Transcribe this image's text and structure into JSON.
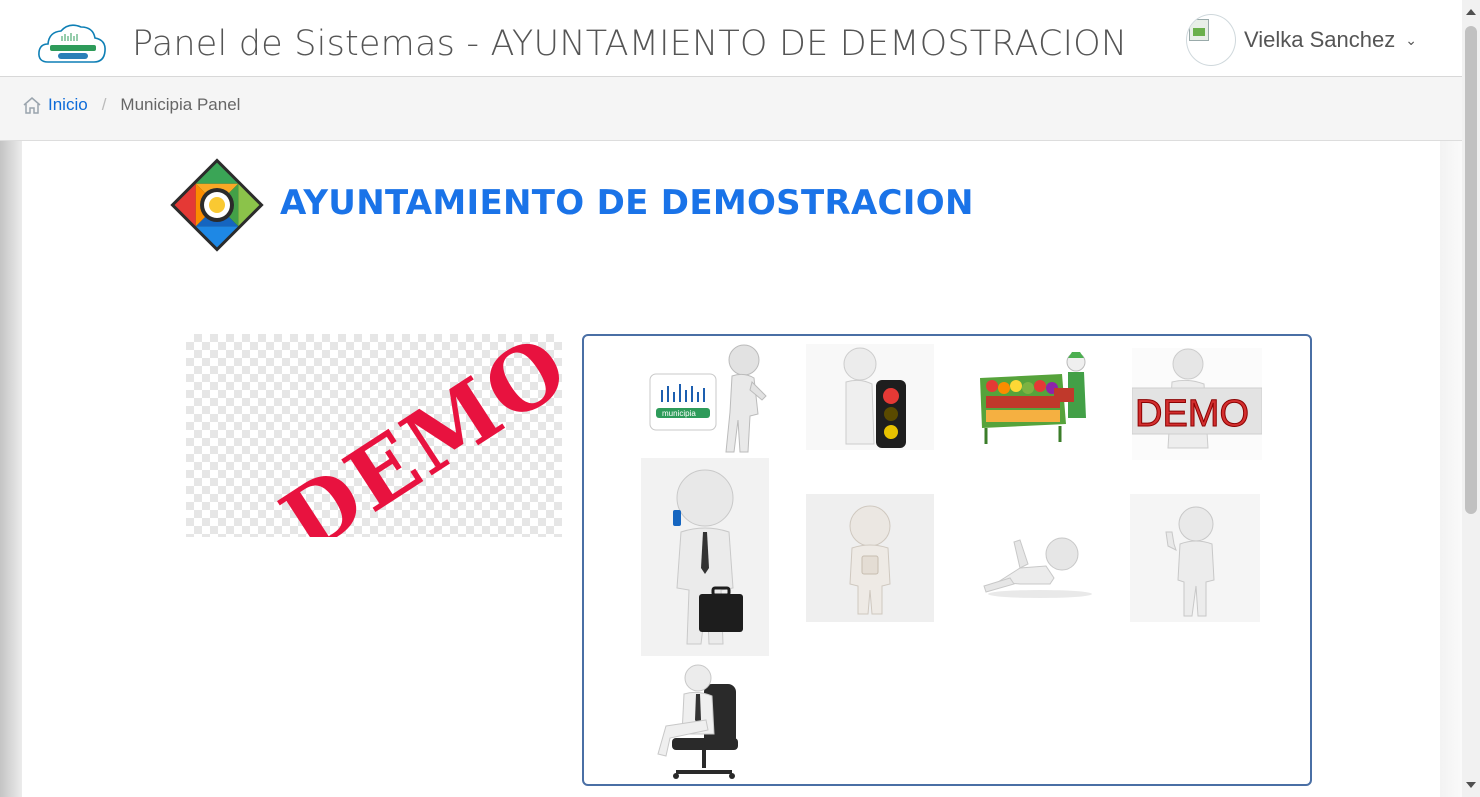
{
  "header": {
    "title": "Panel de Sistemas - AYUNTAMIENTO DE DEMOSTRACION",
    "logo_icon": "municipia-cloud-logo",
    "user": {
      "name": "Vielka Sanchez",
      "caret": "⌄",
      "avatar_icon": "broken-avatar-image"
    }
  },
  "breadcrumb": {
    "home_icon": "home-icon",
    "home_label": "Inicio",
    "separator": "/",
    "current": "Municipia Panel"
  },
  "main": {
    "org_name": "AYUNTAMIENTO DE DEMOSTRACION",
    "org_logo_icon": "municipality-emblem",
    "banner_text": "DEMO",
    "apps": [
      {
        "icon": "municipia-presenter-figure",
        "label": "municipia"
      },
      {
        "icon": "traffic-light-figure"
      },
      {
        "icon": "market-stall-figure"
      },
      {
        "icon": "demo-sign-figure",
        "label": "DEMO"
      },
      {
        "icon": "phone-briefcase-figure"
      },
      {
        "icon": "reading-figure"
      },
      {
        "icon": "relaxing-figure"
      },
      {
        "icon": "thumbs-up-figure"
      },
      {
        "icon": "office-chair-figure"
      }
    ]
  },
  "colors": {
    "accent": "#1a73e8",
    "link": "#0d6bd9",
    "demo_red": "#e8123f",
    "box_border": "#4a6fa5",
    "breadcrumb_bg": "#f5f5f5"
  }
}
